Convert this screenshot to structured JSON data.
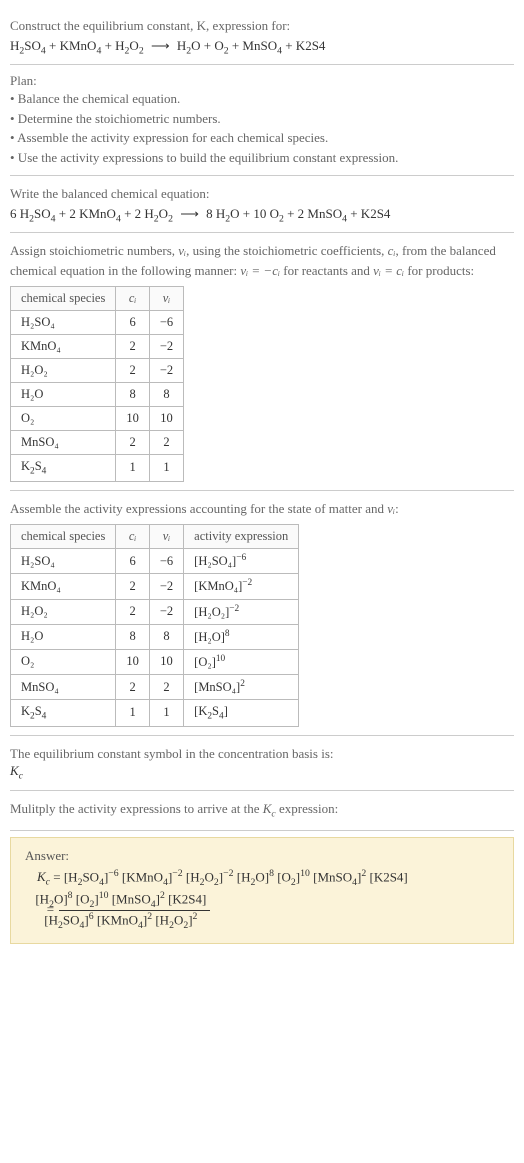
{
  "prompt": {
    "line1": "Construct the equilibrium constant, K, expression for:",
    "equation_text": "H₂SO₄ + KMnO₄ + H₂O₂ ⟶ H₂O + O₂ + MnSO₄ + K2S4"
  },
  "plan": {
    "heading": "Plan:",
    "items": [
      "• Balance the chemical equation.",
      "• Determine the stoichiometric numbers.",
      "• Assemble the activity expression for each chemical species.",
      "• Use the activity expressions to build the equilibrium constant expression."
    ]
  },
  "balanced": {
    "heading": "Write the balanced chemical equation:",
    "equation_text": "6 H₂SO₄ + 2 KMnO₄ + 2 H₂O₂ ⟶ 8 H₂O + 10 O₂ + 2 MnSO₄ + K2S4"
  },
  "stoich": {
    "intro_before_nu": "Assign stoichiometric numbers, ",
    "nu_i": "νᵢ",
    "intro_mid1": ", using the stoichiometric coefficients, ",
    "c_i": "cᵢ",
    "intro_mid2": ", from the balanced chemical equation in the following manner: ",
    "rel_reactants": "νᵢ = −cᵢ",
    "for_reactants": " for reactants and ",
    "rel_products": "νᵢ = cᵢ",
    "for_products": " for products:",
    "headers": {
      "species": "chemical species",
      "c": "cᵢ",
      "nu": "νᵢ"
    },
    "rows": [
      {
        "species": "H₂SO₄",
        "c": "6",
        "nu": "−6"
      },
      {
        "species": "KMnO₄",
        "c": "2",
        "nu": "−2"
      },
      {
        "species": "H₂O₂",
        "c": "2",
        "nu": "−2"
      },
      {
        "species": "H₂O",
        "c": "8",
        "nu": "8"
      },
      {
        "species": "O₂",
        "c": "10",
        "nu": "10"
      },
      {
        "species": "MnSO₄",
        "c": "2",
        "nu": "2"
      },
      {
        "species": "K2S4",
        "c": "1",
        "nu": "1"
      }
    ]
  },
  "activity": {
    "intro_before": "Assemble the activity expressions accounting for the state of matter and ",
    "nu_i": "νᵢ",
    "intro_after": ":",
    "headers": {
      "species": "chemical species",
      "c": "cᵢ",
      "nu": "νᵢ",
      "act": "activity expression"
    },
    "rows": [
      {
        "species": "H₂SO₄",
        "c": "6",
        "nu": "−6",
        "base": "[H₂SO₄]",
        "exp": "−6"
      },
      {
        "species": "KMnO₄",
        "c": "2",
        "nu": "−2",
        "base": "[KMnO₄]",
        "exp": "−2"
      },
      {
        "species": "H₂O₂",
        "c": "2",
        "nu": "−2",
        "base": "[H₂O₂]",
        "exp": "−2"
      },
      {
        "species": "H₂O",
        "c": "8",
        "nu": "8",
        "base": "[H₂O]",
        "exp": "8"
      },
      {
        "species": "O₂",
        "c": "10",
        "nu": "10",
        "base": "[O₂]",
        "exp": "10"
      },
      {
        "species": "MnSO₄",
        "c": "2",
        "nu": "2",
        "base": "[MnSO₄]",
        "exp": "2"
      },
      {
        "species": "K2S4",
        "c": "1",
        "nu": "1",
        "base": "[K2S4]",
        "exp": ""
      }
    ]
  },
  "basis": {
    "intro": "The equilibrium constant symbol in the concentration basis is:",
    "symbol": "K꜀"
  },
  "final": {
    "heading": "Mulitply the activity expressions to arrive at the K꜀ expression:",
    "answer_label": "Answer:",
    "kc": "K꜀",
    "eq": " = ",
    "line1_terms": "[H₂SO₄]⁻⁶ [KMnO₄]⁻² [H₂O₂]⁻² [H₂O]⁸ [O₂]¹⁰ [MnSO₄]² [K2S4]",
    "frac_num": "[H₂O]⁸ [O₂]¹⁰ [MnSO₄]² [K2S4]",
    "frac_den": "[H₂SO₄]⁶ [KMnO₄]² [H₂O₂]²"
  },
  "chart_data": {
    "type": "table",
    "tables": [
      {
        "title": "Stoichiometric numbers",
        "columns": [
          "chemical species",
          "cᵢ",
          "νᵢ"
        ],
        "rows": [
          [
            "H₂SO₄",
            6,
            -6
          ],
          [
            "KMnO₄",
            2,
            -2
          ],
          [
            "H₂O₂",
            2,
            -2
          ],
          [
            "H₂O",
            8,
            8
          ],
          [
            "O₂",
            10,
            10
          ],
          [
            "MnSO₄",
            2,
            2
          ],
          [
            "K2S4",
            1,
            1
          ]
        ]
      },
      {
        "title": "Activity expressions",
        "columns": [
          "chemical species",
          "cᵢ",
          "νᵢ",
          "activity expression"
        ],
        "rows": [
          [
            "H₂SO₄",
            6,
            -6,
            "[H₂SO₄]^(-6)"
          ],
          [
            "KMnO₄",
            2,
            -2,
            "[KMnO₄]^(-2)"
          ],
          [
            "H₂O₂",
            2,
            -2,
            "[H₂O₂]^(-2)"
          ],
          [
            "H₂O",
            8,
            8,
            "[H₂O]^8"
          ],
          [
            "O₂",
            10,
            10,
            "[O₂]^10"
          ],
          [
            "MnSO₄",
            2,
            2,
            "[MnSO₄]^2"
          ],
          [
            "K2S4",
            1,
            1,
            "[K2S4]"
          ]
        ]
      }
    ]
  }
}
